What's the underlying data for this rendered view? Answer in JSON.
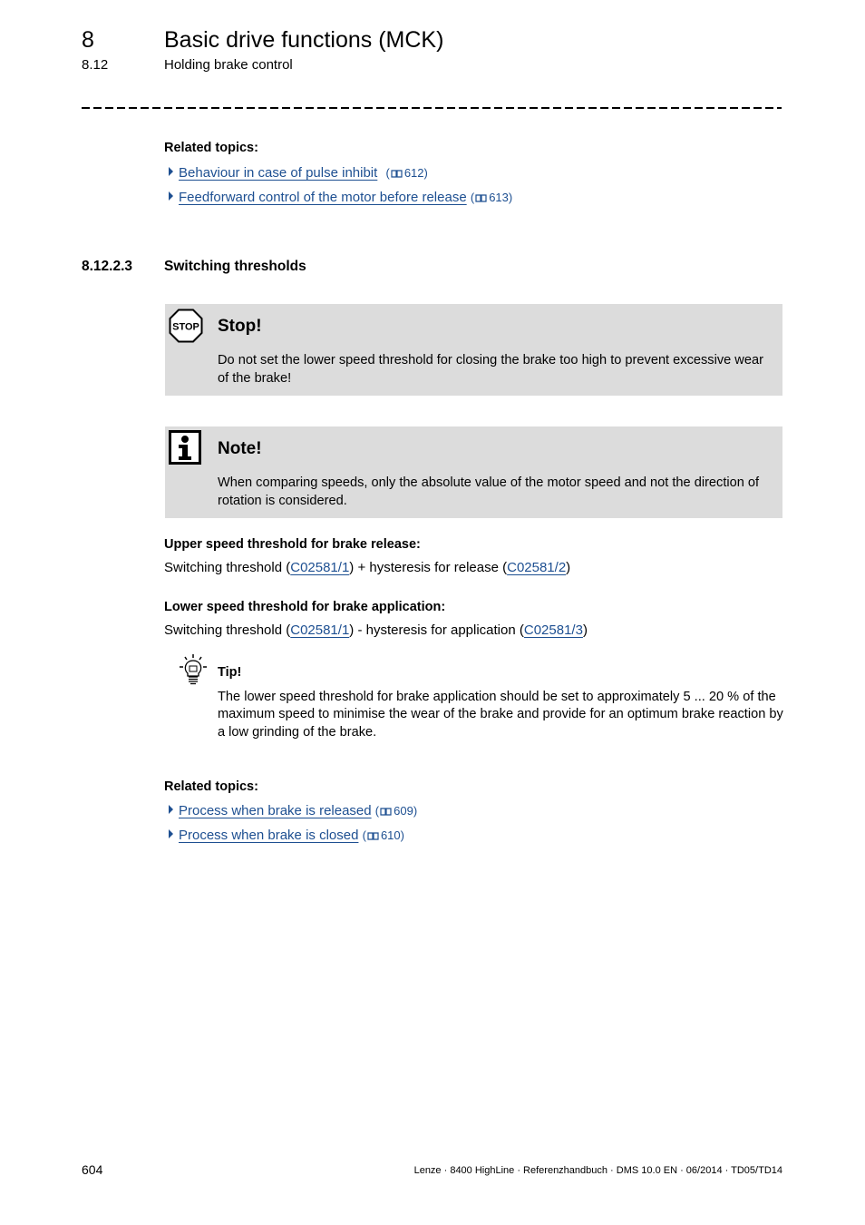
{
  "header": {
    "chapter_number": "8",
    "chapter_title": "Basic drive functions (MCK)",
    "section_number": "8.12",
    "section_title": "Holding brake control"
  },
  "related_topics_top": {
    "heading": "Related topics:",
    "items": [
      {
        "label": "Behaviour in case of pulse inhibit",
        "page": "612"
      },
      {
        "label": "Feedforward control of the motor before release",
        "page": "613"
      }
    ]
  },
  "subsection": {
    "number": "8.12.2.3",
    "title": "Switching thresholds"
  },
  "stop_box": {
    "icon": "stop-sign-icon",
    "icon_text": "STOP",
    "title": "Stop!",
    "text": "Do not set the lower speed threshold for closing the brake too high to prevent excessive wear of the brake!"
  },
  "note_box": {
    "icon": "info-icon",
    "title": "Note!",
    "text": "When comparing speeds, only the absolute value of the motor speed and not the direction of rotation is considered."
  },
  "upper_threshold": {
    "heading": "Upper speed threshold for brake release:",
    "prefix": "Switching threshold (",
    "code1": "C02581/1",
    "middle": ") + hysteresis for release (",
    "code2": "C02581/2",
    "suffix": ")"
  },
  "lower_threshold": {
    "heading": "Lower speed threshold for brake application:",
    "prefix": "Switching threshold (",
    "code1": "C02581/1",
    "middle": ") - hysteresis for application (",
    "code2": "C02581/3",
    "suffix": ")"
  },
  "tip": {
    "icon": "lightbulb-icon",
    "title": "Tip!",
    "text": "The lower speed threshold for brake application should be set to approximately 5 ... 20 % of the maximum speed to minimise the wear of the brake and provide for an optimum brake reaction by a low grinding of the brake."
  },
  "related_topics_bottom": {
    "heading": "Related topics:",
    "items": [
      {
        "label": "Process when brake is released",
        "page": "609"
      },
      {
        "label": "Process when brake is closed",
        "page": "610"
      }
    ]
  },
  "footer": {
    "page_number": "604",
    "info": "Lenze · 8400 HighLine · Referenzhandbuch · DMS 10.0 EN · 06/2014 · TD05/TD14"
  },
  "colors": {
    "link": "#1d4f91",
    "box_background": "#dcdcdc"
  }
}
